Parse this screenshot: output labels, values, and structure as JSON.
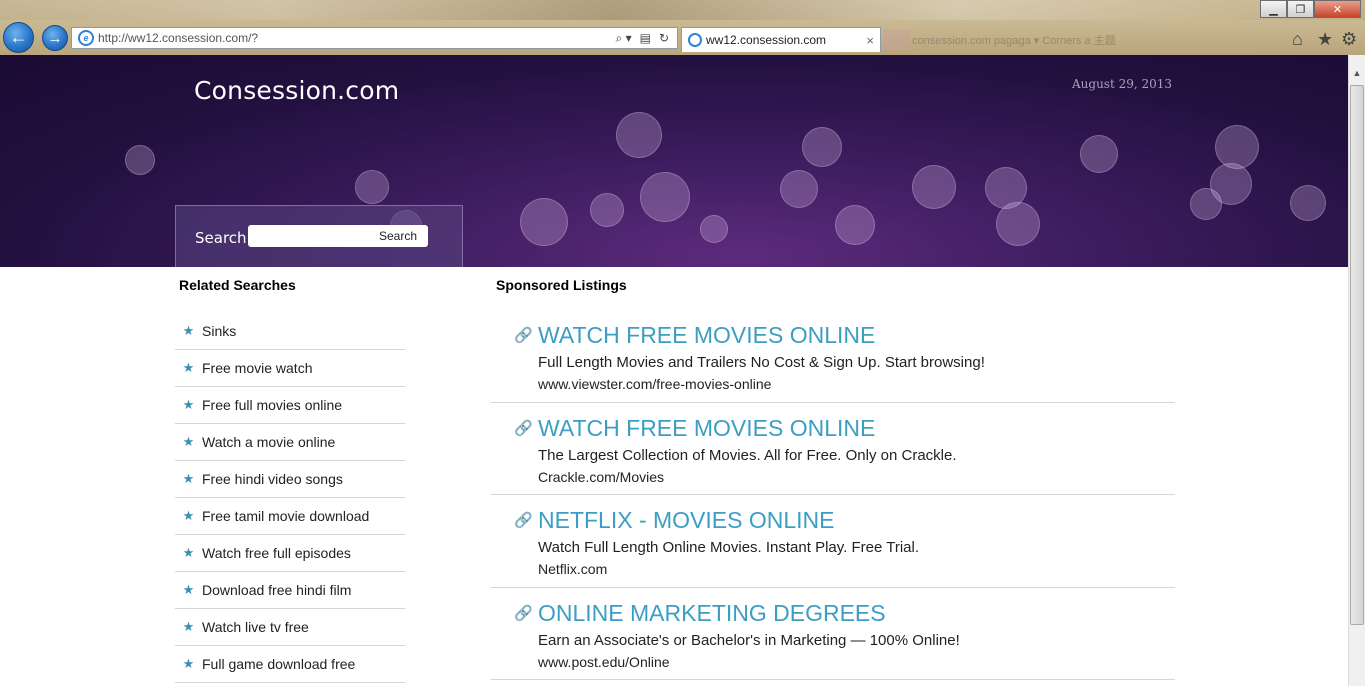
{
  "browser": {
    "address": "http://ww12.consession.com/?",
    "tab_title": "ww12.consession.com",
    "blurred_tabs": "consession.com  pagaga  ▾    Corners  a  主题",
    "back_glyph": "←",
    "forward_glyph": "→",
    "close_glyph": "×"
  },
  "site": {
    "title": "Consession.com",
    "date": "August 29, 2013"
  },
  "search": {
    "label": "Search",
    "button_label": "Search",
    "value": ""
  },
  "related": {
    "heading": "Related Searches",
    "items": [
      "Sinks",
      "Free movie watch",
      "Free full movies online",
      "Watch a movie online",
      "Free hindi video songs",
      "Free tamil movie download",
      "Watch free full episodes",
      "Download free hindi film",
      "Watch live tv free",
      "Full game download free"
    ]
  },
  "sponsored": {
    "heading": "Sponsored Listings",
    "listings": [
      {
        "title": "WATCH FREE MOVIES ONLINE",
        "desc": "Full Length Movies and Trailers No Cost & Sign Up. Start browsing!",
        "url": "www.viewster.com/free-movies-online"
      },
      {
        "title": "WATCH FREE MOVIES ONLINE",
        "desc": "The Largest Collection of Movies. All for Free. Only on Crackle.",
        "url": "Crackle.com/Movies"
      },
      {
        "title": "NETFLIX - MOVIES ONLINE",
        "desc": "Watch Full Length Online Movies. Instant Play. Free Trial.",
        "url": "Netflix.com"
      },
      {
        "title": "ONLINE MARKETING DEGREES",
        "desc": "Earn an Associate's or Bachelor's in Marketing — 100% Online!",
        "url": "www.post.edu/Online"
      }
    ]
  },
  "icons": {
    "related_item": "star-icon",
    "listing": "link-icon",
    "star_color": "#3a8fb5",
    "link_title_color": "#3d9ec4"
  }
}
